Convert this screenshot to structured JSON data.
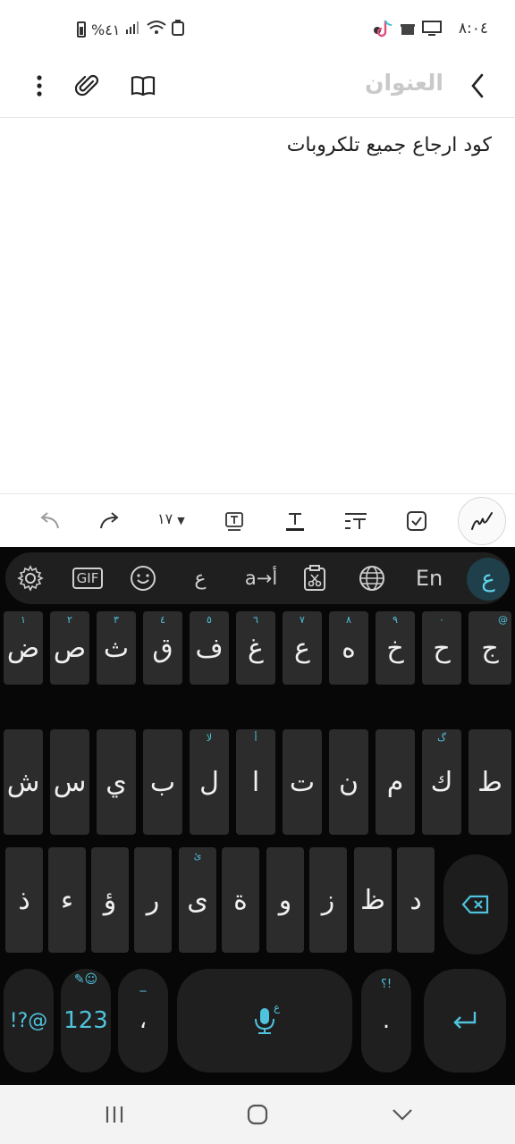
{
  "status_bar": {
    "time": "٨:٠٤",
    "battery": "%٤١",
    "icons": [
      "monitor-icon",
      "notification-icon",
      "tiktok-icon",
      "signal-icon",
      "wifi-icon",
      "recycle-icon",
      "battery-icon"
    ]
  },
  "header": {
    "title_placeholder": "العنوان"
  },
  "editor": {
    "content": "كود ارجاع جميع تلكروبات"
  },
  "toolbar": {
    "font_size": "١٧"
  },
  "keyboard": {
    "top_bar": {
      "translit": "a→أ",
      "lang_en": "En",
      "lang_ar": "ع",
      "gif": "GIF",
      "ar_glyph": "ع"
    },
    "rows": [
      [
        {
          "label": "ض",
          "hint": "١"
        },
        {
          "label": "ص",
          "hint": "٢"
        },
        {
          "label": "ث",
          "hint": "٣"
        },
        {
          "label": "ق",
          "hint": "٤"
        },
        {
          "label": "ف",
          "hint": "٥"
        },
        {
          "label": "غ",
          "hint": "٦"
        },
        {
          "label": "ع",
          "hint": "٧"
        },
        {
          "label": "ه",
          "hint": "٨"
        },
        {
          "label": "خ",
          "hint": "٩"
        },
        {
          "label": "ح",
          "hint": "٠"
        },
        {
          "label": "ج",
          "hint": "@"
        }
      ],
      [
        {
          "label": "ش",
          "hint": ""
        },
        {
          "label": "س",
          "hint": ""
        },
        {
          "label": "ي",
          "hint": ""
        },
        {
          "label": "ب",
          "hint": ""
        },
        {
          "label": "ل",
          "hint": "لا"
        },
        {
          "label": "ا",
          "hint": "أ"
        },
        {
          "label": "ت",
          "hint": ""
        },
        {
          "label": "ن",
          "hint": ""
        },
        {
          "label": "م",
          "hint": ""
        },
        {
          "label": "ك",
          "hint": "گ"
        },
        {
          "label": "ط",
          "hint": ""
        }
      ],
      [
        {
          "label": "ذ",
          "hint": ""
        },
        {
          "label": "ء",
          "hint": ""
        },
        {
          "label": "ؤ",
          "hint": ""
        },
        {
          "label": "ر",
          "hint": ""
        },
        {
          "label": "ى",
          "hint": "ئ"
        },
        {
          "label": "ة",
          "hint": ""
        },
        {
          "label": "و",
          "hint": ""
        },
        {
          "label": "ز",
          "hint": ""
        },
        {
          "label": "ظ",
          "hint": ""
        },
        {
          "label": "د",
          "hint": ""
        }
      ]
    ],
    "bottom": {
      "symbols": "!?@",
      "numbers": "123",
      "comma": "،",
      "comma_hint": "_",
      "mic_hint": "ع",
      "period": ".",
      "period_hint": "؟!",
      "enter": "↵"
    }
  },
  "colors": {
    "accent": "#4fc3dd",
    "keyboard_bg": "#070707",
    "key_bg": "#2c2c2c",
    "placeholder": "#c9c9c9"
  }
}
